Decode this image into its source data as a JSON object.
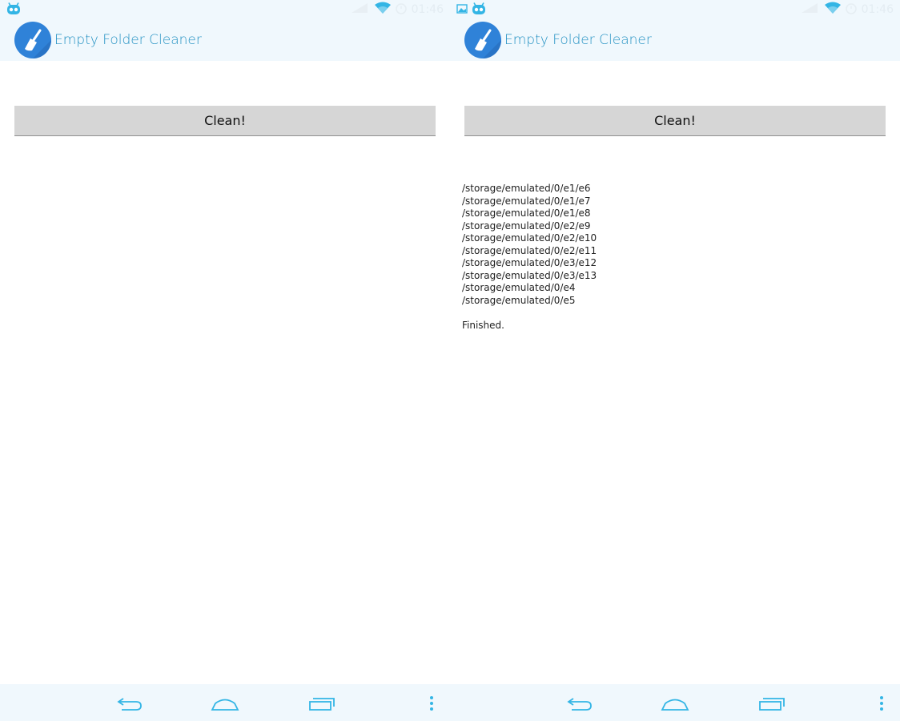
{
  "colors": {
    "status_bg": "#f0f8fd",
    "title": "#2592c3",
    "app_icon_bg": "#2f82d8",
    "nav_icon": "#33b5e5",
    "button_bg": "#d6d6d6"
  },
  "left_screen": {
    "status_bar": {
      "left_icons": [
        "cyanogen-icon"
      ],
      "right_icons": [
        "signal-icon",
        "wifi-icon",
        "alarm-icon"
      ],
      "time": "01:46"
    },
    "action_bar": {
      "title": "Empty Folder Cleaner",
      "icon": "broom-icon"
    },
    "clean_button_label": "Clean!",
    "nav_bar": {
      "icons": [
        "back-icon",
        "home-icon",
        "recents-icon",
        "menu-icon"
      ]
    }
  },
  "right_screen": {
    "status_bar": {
      "left_icons": [
        "image-icon",
        "cyanogen-icon"
      ],
      "right_icons": [
        "signal-icon",
        "wifi-icon",
        "alarm-icon"
      ],
      "time": "01:46"
    },
    "action_bar": {
      "title": "Empty Folder Cleaner",
      "icon": "broom-icon"
    },
    "clean_button_label": "Clean!",
    "log_lines": [
      "/storage/emulated/0/e1/e6",
      "/storage/emulated/0/e1/e7",
      "/storage/emulated/0/e1/e8",
      "/storage/emulated/0/e2/e9",
      "/storage/emulated/0/e2/e10",
      "/storage/emulated/0/e2/e11",
      "/storage/emulated/0/e3/e12",
      "/storage/emulated/0/e3/e13",
      "/storage/emulated/0/e4",
      "/storage/emulated/0/e5"
    ],
    "finished_text": "Finished.",
    "nav_bar": {
      "icons": [
        "back-icon",
        "home-icon",
        "recents-icon",
        "menu-icon"
      ]
    }
  }
}
